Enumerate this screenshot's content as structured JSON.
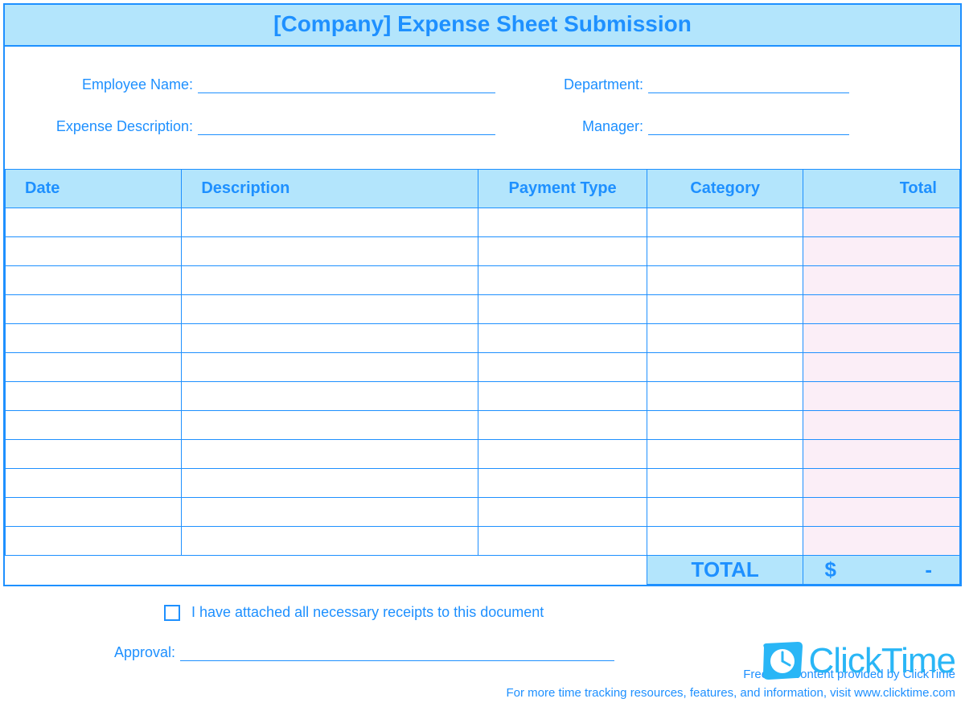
{
  "title": "[Company] Expense Sheet Submission",
  "fields": {
    "employee_name_label": "Employee Name:",
    "employee_name_value": "",
    "department_label": "Department:",
    "department_value": "",
    "expense_desc_label": "Expense Description:",
    "expense_desc_value": "",
    "manager_label": "Manager:",
    "manager_value": ""
  },
  "table": {
    "headers": {
      "date": "Date",
      "description": "Description",
      "payment_type": "Payment Type",
      "category": "Category",
      "total": "Total"
    },
    "rows": [
      {
        "date": "",
        "description": "",
        "payment_type": "",
        "category": "",
        "total": ""
      },
      {
        "date": "",
        "description": "",
        "payment_type": "",
        "category": "",
        "total": ""
      },
      {
        "date": "",
        "description": "",
        "payment_type": "",
        "category": "",
        "total": ""
      },
      {
        "date": "",
        "description": "",
        "payment_type": "",
        "category": "",
        "total": ""
      },
      {
        "date": "",
        "description": "",
        "payment_type": "",
        "category": "",
        "total": ""
      },
      {
        "date": "",
        "description": "",
        "payment_type": "",
        "category": "",
        "total": ""
      },
      {
        "date": "",
        "description": "",
        "payment_type": "",
        "category": "",
        "total": ""
      },
      {
        "date": "",
        "description": "",
        "payment_type": "",
        "category": "",
        "total": ""
      },
      {
        "date": "",
        "description": "",
        "payment_type": "",
        "category": "",
        "total": ""
      },
      {
        "date": "",
        "description": "",
        "payment_type": "",
        "category": "",
        "total": ""
      },
      {
        "date": "",
        "description": "",
        "payment_type": "",
        "category": "",
        "total": ""
      },
      {
        "date": "",
        "description": "",
        "payment_type": "",
        "category": "",
        "total": ""
      }
    ],
    "grand_total_label": "TOTAL",
    "grand_total_currency": "$",
    "grand_total_value": "-"
  },
  "receipt_checkbox_label": "I have attached all necessary receipts to this document",
  "receipt_checkbox_checked": false,
  "approval_label": "Approval:",
  "approval_value": "",
  "brand": {
    "name": "ClickTime",
    "line1": "Free use content provided by ClickTime",
    "line2": "For more time tracking resources, features, and information, visit www.clicktime.com"
  }
}
